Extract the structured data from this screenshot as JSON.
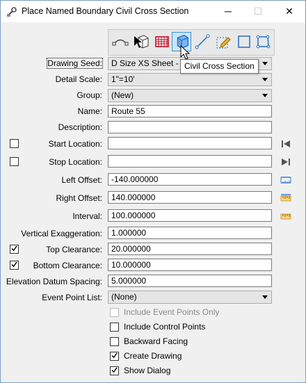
{
  "window": {
    "title": "Place Named Boundary Civil Cross Section",
    "minimize_glyph": "─",
    "maximize_glyph": "☐",
    "close_glyph": "✕"
  },
  "toolbar": {
    "buttons": [
      {
        "icon": "civil-plan-icon"
      },
      {
        "icon": "select-box-icon"
      },
      {
        "icon": "grid-icon"
      },
      {
        "icon": "civil-cross-section-icon",
        "selected": true
      },
      {
        "icon": "line-icon"
      },
      {
        "icon": "pencil-box-icon"
      },
      {
        "icon": "square-icon"
      },
      {
        "icon": "polygon-icon"
      }
    ],
    "tooltip": "Civil Cross Section"
  },
  "form": {
    "drawing_seed_label": "Drawing Seed:",
    "drawing_seed_value": "D Size XS Sheet - 10",
    "detail_scale_label": "Detail Scale:",
    "detail_scale_value": "1\"=10'",
    "group_label": "Group:",
    "group_value": "(New)",
    "name_label": "Name:",
    "name_value": "Route 55",
    "description_label": "Description:",
    "description_value": "",
    "start_location_label": "Start Location:",
    "start_location_value": "",
    "stop_location_label": "Stop Location:",
    "stop_location_value": "",
    "left_offset_label": "Left Offset:",
    "left_offset_value": "-140.000000",
    "right_offset_label": "Right Offset:",
    "right_offset_value": "140.000000",
    "interval_label": "Interval:",
    "interval_value": "100.000000",
    "vertical_exaggeration_label": "Vertical Exaggeration:",
    "vertical_exaggeration_value": "1.000000",
    "top_clearance_label": "Top Clearance:",
    "top_clearance_value": "20.000000",
    "top_clearance_checked": true,
    "bottom_clearance_label": "Bottom Clearance:",
    "bottom_clearance_value": "10.000000",
    "bottom_clearance_checked": true,
    "elevation_datum_spacing_label": "Elevation Datum Spacing:",
    "elevation_datum_spacing_value": "5.000000",
    "event_point_list_label": "Event Point List:",
    "event_point_list_value": "(None)"
  },
  "options": [
    {
      "label": "Include Event Points Only",
      "checked": false,
      "disabled": true
    },
    {
      "label": "Include Control Points",
      "checked": false,
      "disabled": false
    },
    {
      "label": "Backward Facing",
      "checked": false,
      "disabled": false
    },
    {
      "label": "Create Drawing",
      "checked": true,
      "disabled": false
    },
    {
      "label": "Show Dialog",
      "checked": true,
      "disabled": false
    }
  ],
  "colors": {
    "accent": "#3c8fd8",
    "tool_blue": "#1e6fc7",
    "grid_red": "#c0001a",
    "ruler_blue": "#3a7bd5",
    "ruler_orange": "#d89a2a"
  }
}
